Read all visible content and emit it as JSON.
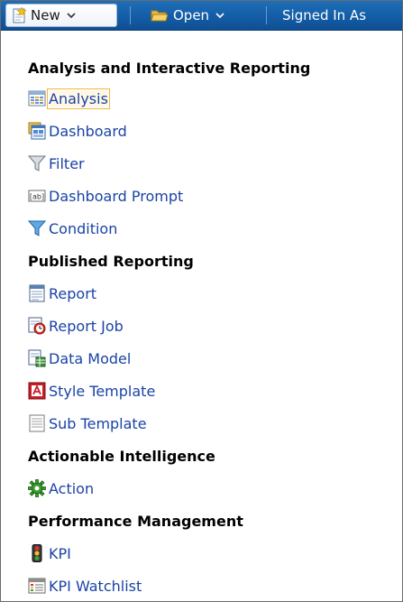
{
  "toolbar": {
    "new_label": "New",
    "open_label": "Open",
    "signed_in_label": "Signed In As"
  },
  "menu": {
    "sections": [
      {
        "title": "Analysis and Interactive Reporting",
        "items": [
          {
            "label": "Analysis",
            "icon": "analysis-icon"
          },
          {
            "label": "Dashboard",
            "icon": "dashboard-icon"
          },
          {
            "label": "Filter",
            "icon": "filter-icon"
          },
          {
            "label": "Dashboard Prompt",
            "icon": "dashboard-prompt-icon"
          },
          {
            "label": "Condition",
            "icon": "condition-icon"
          }
        ]
      },
      {
        "title": "Published Reporting",
        "items": [
          {
            "label": "Report",
            "icon": "report-icon"
          },
          {
            "label": "Report Job",
            "icon": "report-job-icon"
          },
          {
            "label": "Data Model",
            "icon": "data-model-icon"
          },
          {
            "label": "Style Template",
            "icon": "style-template-icon"
          },
          {
            "label": "Sub Template",
            "icon": "sub-template-icon"
          }
        ]
      },
      {
        "title": "Actionable Intelligence",
        "items": [
          {
            "label": "Action",
            "icon": "action-gear-icon"
          }
        ]
      },
      {
        "title": "Performance Management",
        "items": [
          {
            "label": "KPI",
            "icon": "kpi-traffic-light-icon"
          },
          {
            "label": "KPI Watchlist",
            "icon": "kpi-watchlist-icon"
          }
        ]
      }
    ]
  },
  "colors": {
    "toolbar_blue": "#145ea8",
    "link_blue": "#1a43a6",
    "focus_outline": "#f3b542"
  }
}
